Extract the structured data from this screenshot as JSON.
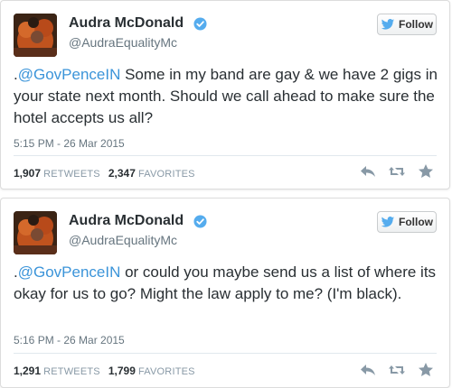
{
  "tweets": [
    {
      "author": {
        "name": "Audra McDonald",
        "handle": "@AudraEqualityMc"
      },
      "follow_label": "Follow",
      "mention": "@GovPenceIN",
      "prefix": ".",
      "body": " Some in my band are gay & we have 2 gigs in your state next month. Should we call ahead to make sure the hotel accepts us all?",
      "timestamp": "5:15 PM - 26 Mar 2015",
      "retweets": "1,907",
      "retweets_label": "RETWEETS",
      "favorites": "2,347",
      "favorites_label": "FAVORITES"
    },
    {
      "author": {
        "name": "Audra McDonald",
        "handle": "@AudraEqualityMc"
      },
      "follow_label": "Follow",
      "mention": "@GovPenceIN",
      "prefix": ".",
      "body": " or could you maybe send us a list of where its okay for us to go? Might the law apply to me? (I'm black).",
      "timestamp": "5:16 PM - 26 Mar 2015",
      "retweets": "1,291",
      "retweets_label": "RETWEETS",
      "favorites": "1,799",
      "favorites_label": "FAVORITES"
    }
  ],
  "colors": {
    "link": "#3b94d9",
    "verified": "#55acee",
    "twitter_bird": "#55acee",
    "muted": "#66757f",
    "action_icon": "#8899a6"
  },
  "icons": [
    "verified-badge-icon",
    "twitter-bird-icon",
    "reply-icon",
    "retweet-icon",
    "favorite-star-icon"
  ]
}
